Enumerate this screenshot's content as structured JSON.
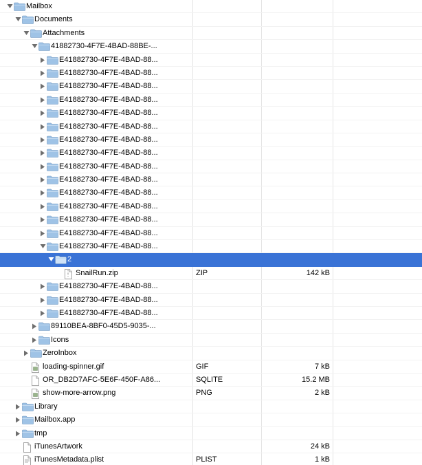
{
  "colors": {
    "selection": "#3a73d6",
    "folder": "#9fc3e6",
    "grid_line": "#e4e4e4"
  },
  "rows": [
    {
      "depth": 0,
      "disclosure": "open",
      "icon": "folder-icon",
      "name": "Mailbox",
      "kind": "",
      "size": ""
    },
    {
      "depth": 1,
      "disclosure": "open",
      "icon": "folder-icon",
      "name": "Documents",
      "kind": "",
      "size": ""
    },
    {
      "depth": 2,
      "disclosure": "open",
      "icon": "folder-icon",
      "name": "Attachments",
      "kind": "",
      "size": ""
    },
    {
      "depth": 3,
      "disclosure": "open",
      "icon": "folder-icon",
      "name": "41882730-4F7E-4BAD-88BE-...",
      "kind": "",
      "size": ""
    },
    {
      "depth": 4,
      "disclosure": "closed",
      "icon": "folder-icon",
      "name": "E41882730-4F7E-4BAD-88...",
      "kind": "",
      "size": ""
    },
    {
      "depth": 4,
      "disclosure": "closed",
      "icon": "folder-icon",
      "name": "E41882730-4F7E-4BAD-88...",
      "kind": "",
      "size": ""
    },
    {
      "depth": 4,
      "disclosure": "closed",
      "icon": "folder-icon",
      "name": "E41882730-4F7E-4BAD-88...",
      "kind": "",
      "size": ""
    },
    {
      "depth": 4,
      "disclosure": "closed",
      "icon": "folder-icon",
      "name": "E41882730-4F7E-4BAD-88...",
      "kind": "",
      "size": ""
    },
    {
      "depth": 4,
      "disclosure": "closed",
      "icon": "folder-icon",
      "name": "E41882730-4F7E-4BAD-88...",
      "kind": "",
      "size": ""
    },
    {
      "depth": 4,
      "disclosure": "closed",
      "icon": "folder-icon",
      "name": "E41882730-4F7E-4BAD-88...",
      "kind": "",
      "size": ""
    },
    {
      "depth": 4,
      "disclosure": "closed",
      "icon": "folder-icon",
      "name": "E41882730-4F7E-4BAD-88...",
      "kind": "",
      "size": ""
    },
    {
      "depth": 4,
      "disclosure": "closed",
      "icon": "folder-icon",
      "name": "E41882730-4F7E-4BAD-88...",
      "kind": "",
      "size": ""
    },
    {
      "depth": 4,
      "disclosure": "closed",
      "icon": "folder-icon",
      "name": "E41882730-4F7E-4BAD-88...",
      "kind": "",
      "size": ""
    },
    {
      "depth": 4,
      "disclosure": "closed",
      "icon": "folder-icon",
      "name": "E41882730-4F7E-4BAD-88...",
      "kind": "",
      "size": ""
    },
    {
      "depth": 4,
      "disclosure": "closed",
      "icon": "folder-icon",
      "name": "E41882730-4F7E-4BAD-88...",
      "kind": "",
      "size": ""
    },
    {
      "depth": 4,
      "disclosure": "closed",
      "icon": "folder-icon",
      "name": "E41882730-4F7E-4BAD-88...",
      "kind": "",
      "size": ""
    },
    {
      "depth": 4,
      "disclosure": "closed",
      "icon": "folder-icon",
      "name": "E41882730-4F7E-4BAD-88...",
      "kind": "",
      "size": ""
    },
    {
      "depth": 4,
      "disclosure": "closed",
      "icon": "folder-icon",
      "name": "E41882730-4F7E-4BAD-88...",
      "kind": "",
      "size": ""
    },
    {
      "depth": 4,
      "disclosure": "open",
      "icon": "folder-icon",
      "name": "E41882730-4F7E-4BAD-88...",
      "kind": "",
      "size": ""
    },
    {
      "depth": 5,
      "disclosure": "open",
      "icon": "folder-icon",
      "name": "2",
      "kind": "",
      "size": "",
      "selected": true
    },
    {
      "depth": 6,
      "disclosure": "none",
      "icon": "zip-file-icon",
      "name": "SnailRun.zip",
      "kind": "ZIP",
      "size": "142 kB"
    },
    {
      "depth": 4,
      "disclosure": "closed",
      "icon": "folder-icon",
      "name": "E41882730-4F7E-4BAD-88...",
      "kind": "",
      "size": ""
    },
    {
      "depth": 4,
      "disclosure": "closed",
      "icon": "folder-icon",
      "name": "E41882730-4F7E-4BAD-88...",
      "kind": "",
      "size": ""
    },
    {
      "depth": 4,
      "disclosure": "closed",
      "icon": "folder-icon",
      "name": "E41882730-4F7E-4BAD-88...",
      "kind": "",
      "size": ""
    },
    {
      "depth": 3,
      "disclosure": "closed",
      "icon": "folder-icon",
      "name": "89110BEA-8BF0-45D5-9035-...",
      "kind": "",
      "size": ""
    },
    {
      "depth": 3,
      "disclosure": "closed",
      "icon": "folder-icon",
      "name": "Icons",
      "kind": "",
      "size": ""
    },
    {
      "depth": 2,
      "disclosure": "closed",
      "icon": "folder-icon",
      "name": "ZeroInbox",
      "kind": "",
      "size": ""
    },
    {
      "depth": 2,
      "disclosure": "none",
      "icon": "image-file-icon",
      "name": "loading-spinner.gif",
      "kind": "GIF",
      "size": "7 kB"
    },
    {
      "depth": 2,
      "disclosure": "none",
      "icon": "blank-file-icon",
      "name": "OR_DB2D7AFC-5E6F-450F-A86...",
      "kind": "SQLITE",
      "size": "15.2 MB"
    },
    {
      "depth": 2,
      "disclosure": "none",
      "icon": "image-file-icon",
      "name": "show-more-arrow.png",
      "kind": "PNG",
      "size": "2 kB"
    },
    {
      "depth": 1,
      "disclosure": "closed",
      "icon": "folder-icon",
      "name": "Library",
      "kind": "",
      "size": ""
    },
    {
      "depth": 1,
      "disclosure": "closed",
      "icon": "folder-icon",
      "name": "Mailbox.app",
      "kind": "",
      "size": ""
    },
    {
      "depth": 1,
      "disclosure": "closed",
      "icon": "folder-icon",
      "name": "tmp",
      "kind": "",
      "size": ""
    },
    {
      "depth": 1,
      "disclosure": "none",
      "icon": "blank-file-icon",
      "name": "iTunesArtwork",
      "kind": "",
      "size": "24 kB"
    },
    {
      "depth": 1,
      "disclosure": "none",
      "icon": "plist-file-icon",
      "name": "iTunesMetadata.plist",
      "kind": "PLIST",
      "size": "1 kB"
    }
  ]
}
